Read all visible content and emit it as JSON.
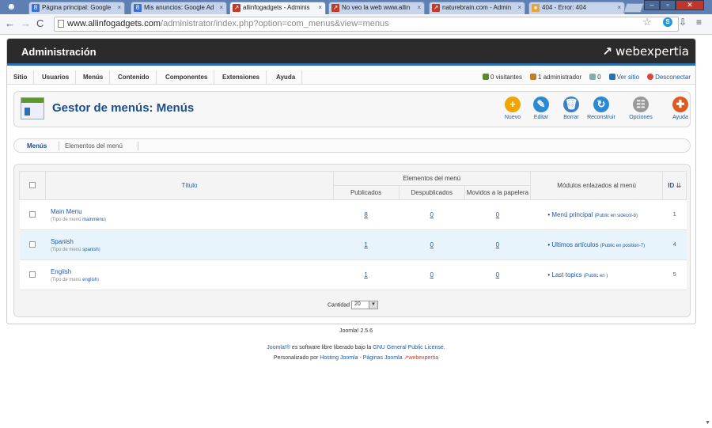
{
  "browser": {
    "tabs": [
      {
        "title": "Página principal: Google",
        "color": "#3b6fd6",
        "glyph": "8"
      },
      {
        "title": "Mis anuncios: Google Ad",
        "color": "#3b6fd6",
        "glyph": "8"
      },
      {
        "title": "allinfogadgets - Adminis",
        "color": "#c0392b",
        "glyph": "↗",
        "active": true
      },
      {
        "title": "No veo la web www.allin",
        "color": "#c0392b",
        "glyph": "↗"
      },
      {
        "title": "naturebrain.com - Admin",
        "color": "#c0392b",
        "glyph": "↗"
      },
      {
        "title": "404 - Error: 404",
        "color": "#e8a33b",
        "glyph": "●"
      }
    ],
    "url_host": "www.allinfogadgets.com",
    "url_path": "/administrator/index.php?option=com_menus&view=menus"
  },
  "admin": {
    "title": "Administración",
    "brand": "webexpertia",
    "menu": [
      "Sitio",
      "Usuarios",
      "Menús",
      "Contenido",
      "Componentes",
      "Extensiones",
      "Ayuda"
    ],
    "status": {
      "visitors": "0 visitantes",
      "admins": "1 administrador",
      "messages": "0",
      "view_site": "Ver sitio",
      "logout": "Desconectar"
    },
    "page_title": "Gestor de menús: Menús",
    "toolbar": [
      {
        "label": "Nuevo",
        "icon": "plus-icon",
        "color": "#f0a500",
        "glyph": "+"
      },
      {
        "label": "Editar",
        "icon": "pencil-icon",
        "color": "#2a8ad4",
        "glyph": "✎"
      },
      {
        "label": "Borrar",
        "icon": "trash-icon",
        "color": "#3a7fc4",
        "glyph": "🗑"
      },
      {
        "label": "Reconstruir",
        "icon": "refresh-icon",
        "color": "#2a8ad4",
        "glyph": "↻"
      },
      {
        "label": "Opciones",
        "icon": "options-icon",
        "color": "#999999",
        "glyph": "☷"
      },
      {
        "label": "Ayuda",
        "icon": "help-icon",
        "color": "#e05a20",
        "glyph": "✚"
      }
    ],
    "subnav": [
      "Menús",
      "Elementos del menú"
    ],
    "table": {
      "col_title": "Título",
      "group_items": "Elementos del menú",
      "col_published": "Publicados",
      "col_unpublished": "Despublicados",
      "col_trashed": "Movidos a la papelera",
      "col_modules": "Módulos enlazados al menú",
      "col_id": "ID",
      "type_prefix": "(Tipo de menú",
      "rows": [
        {
          "name": "Main Menu",
          "type": "mainmenu",
          "published": "8",
          "unpublished": "0",
          "trashed": "0",
          "module": "Menú principal",
          "module_pos": "(Public en sidecol-b)",
          "id": "1"
        },
        {
          "name": "Spanish",
          "type": "spanish",
          "published": "1",
          "unpublished": "0",
          "trashed": "0",
          "module": "Ultimos artículos",
          "module_pos": "(Public en position-7)",
          "id": "4"
        },
        {
          "name": "English",
          "type": "english",
          "published": "1",
          "unpublished": "0",
          "trashed": "0",
          "module": "Last topics",
          "module_pos": "(Public en )",
          "id": "5"
        }
      ]
    },
    "pager": {
      "label": "Cantidad",
      "value": "20"
    }
  },
  "footer": {
    "version": "Joomla! 2.5.6",
    "joomla": "Joomla!®",
    "license_text": "es software libre liberado bajo la",
    "license_link": "GNU General Public License.",
    "custom_text": "Personalizado por",
    "hosting_link": "Hosting Joomla - Páginas Joomla",
    "brand": "webexpertia"
  }
}
